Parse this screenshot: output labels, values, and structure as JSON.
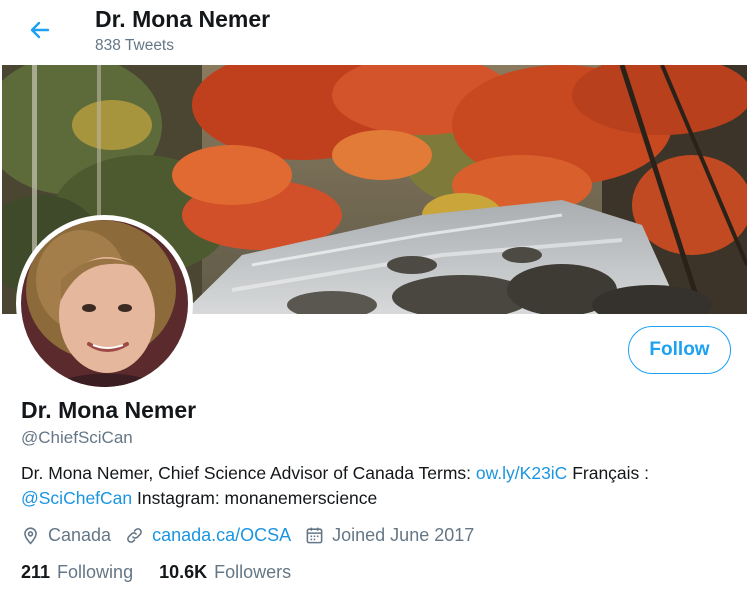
{
  "header": {
    "title": "Dr. Mona Nemer",
    "tweet_count": "838 Tweets",
    "back_icon": "arrow-left-icon",
    "accent": "#1da1f2"
  },
  "banner": {
    "description_icon": "banner-image"
  },
  "profile": {
    "display_name": "Dr. Mona Nemer",
    "handle": "@ChiefSciCan",
    "follow_label": "Follow",
    "bio": {
      "part1": "Dr. Mona Nemer, Chief Science Advisor of Canada Terms: ",
      "link1": "ow.ly/K23iC",
      "part2": " Français : ",
      "mention": "@SciChefCan",
      "part3": " Instagram: monanemerscience"
    },
    "location": "Canada",
    "website": "canada.ca/OCSA",
    "joined": "Joined June 2017",
    "following_count": "211",
    "following_label": "Following",
    "followers_count": "10.6K",
    "followers_label": "Followers"
  },
  "colors": {
    "link": "#1b95e0",
    "muted": "#657786",
    "text": "#14171a"
  }
}
